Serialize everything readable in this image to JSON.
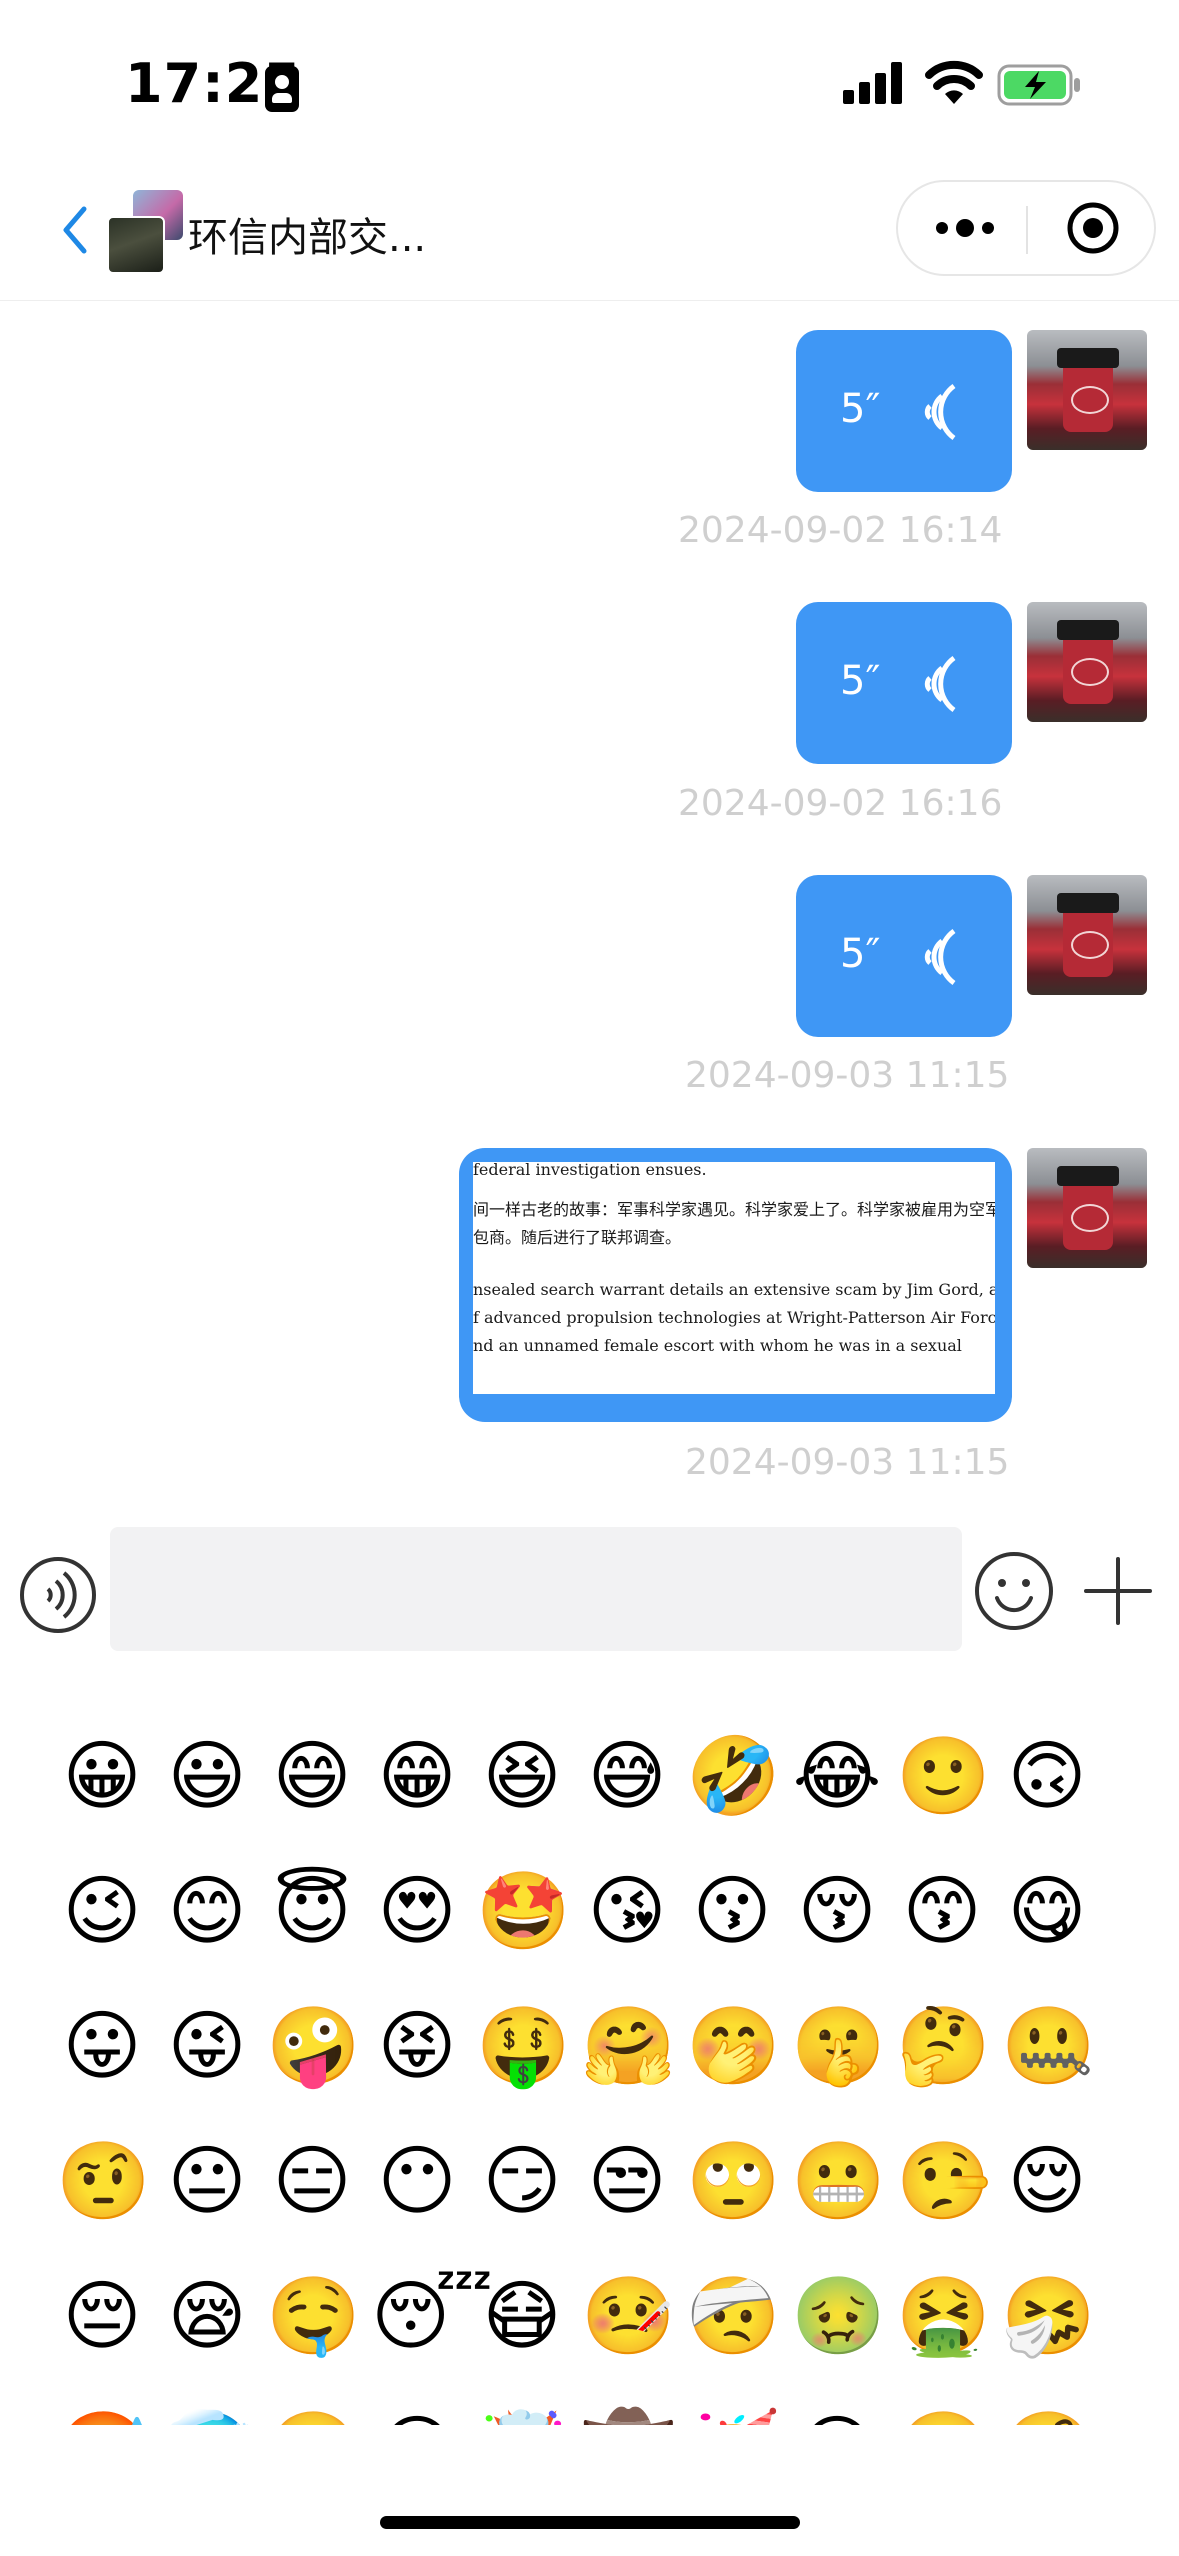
{
  "status_bar": {
    "time": "17:25"
  },
  "header": {
    "title": "环信内部交..."
  },
  "messages": [
    {
      "type": "voice",
      "duration": "5″",
      "timestamp": "2024-09-02 16:14"
    },
    {
      "type": "voice",
      "duration": "5″",
      "timestamp": "2024-09-02 16:16"
    },
    {
      "type": "voice",
      "duration": "5″",
      "timestamp": "2024-09-03 11:15"
    },
    {
      "type": "image",
      "timestamp": "2024-09-03 11:15",
      "image_text": [
        "federal investigation ensues.",
        "间一样古老的故事：军事科学家遇见。科学家爱上了。科学家被雇用为空军",
        "包商。随后进行了联邦调查。",
        "nsealed search warrant details an extensive scam by Jim Gord, a senior",
        "f advanced propulsion technologies at Wright-Patterson Air Force",
        "nd an unnamed female escort with whom he was in a sexual"
      ]
    }
  ],
  "input_bar": {
    "placeholder": ""
  },
  "emoji_panel": {
    "rows": [
      [
        "😀",
        "😃",
        "😄",
        "😁",
        "😆",
        "😅",
        "🤣",
        "😂",
        "🙂",
        "🙃"
      ],
      [
        "😉",
        "😊",
        "😇",
        "😍",
        "🤩",
        "😘",
        "😗",
        "😚",
        "😙",
        "😋"
      ],
      [
        "😛",
        "😜",
        "🤪",
        "😝",
        "🤑",
        "🤗",
        "🤭",
        "🤫",
        "🤔",
        "🤐"
      ],
      [
        "🤨",
        "😐",
        "😑",
        "😶",
        "😏",
        "😒",
        "🙄",
        "😬",
        "🤥",
        "😌"
      ],
      [
        "😔",
        "😪",
        "🤤",
        "😴",
        "😷",
        "🤒",
        "🤕",
        "🤢",
        "🤮",
        "🤧"
      ],
      [
        "🥵",
        "🥶",
        "🥴",
        "😵",
        "🤯",
        "🤠",
        "🥳",
        "😎",
        "🤓",
        "🧐"
      ]
    ]
  },
  "colors": {
    "bubble": "#3f97f5",
    "timestamp": "#cfcfcf",
    "input_bg": "#f2f2f3",
    "battery_fill": "#4cd964"
  }
}
